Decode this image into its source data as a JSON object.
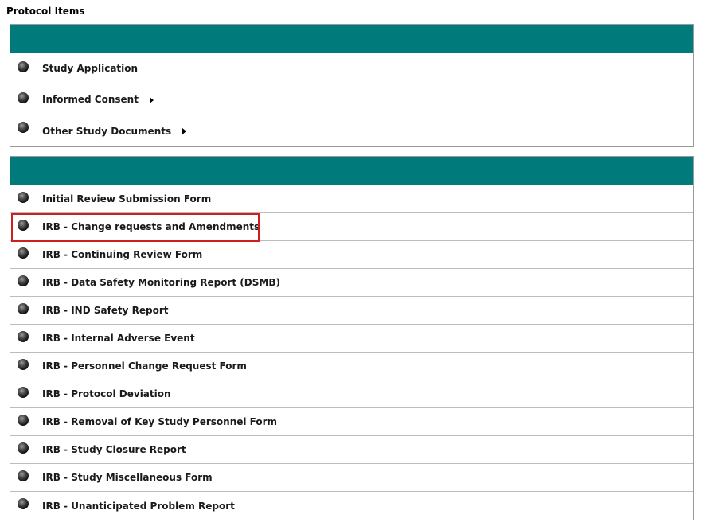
{
  "title": "Protocol Items",
  "panel1": {
    "items": [
      {
        "label": "Study Application"
      },
      {
        "label": "Informed Consent"
      },
      {
        "label": "Other Study Documents"
      }
    ]
  },
  "panel2": {
    "items": [
      {
        "label": "Initial Review Submission Form"
      },
      {
        "label": "IRB - Change requests and Amendments"
      },
      {
        "label": "IRB - Continuing Review Form"
      },
      {
        "label": "IRB - Data Safety Monitoring Report (DSMB)"
      },
      {
        "label": "IRB - IND Safety Report"
      },
      {
        "label": "IRB - Internal Adverse Event"
      },
      {
        "label": "IRB - Personnel Change Request Form"
      },
      {
        "label": "IRB - Protocol Deviation"
      },
      {
        "label": "IRB - Removal of Key Study Personnel Form"
      },
      {
        "label": "IRB - Study Closure Report"
      },
      {
        "label": "IRB - Study Miscellaneous Form"
      },
      {
        "label": "IRB - Unanticipated Problem Report"
      }
    ]
  },
  "colors": {
    "header": "#007a7a",
    "highlight": "#cc2020"
  }
}
